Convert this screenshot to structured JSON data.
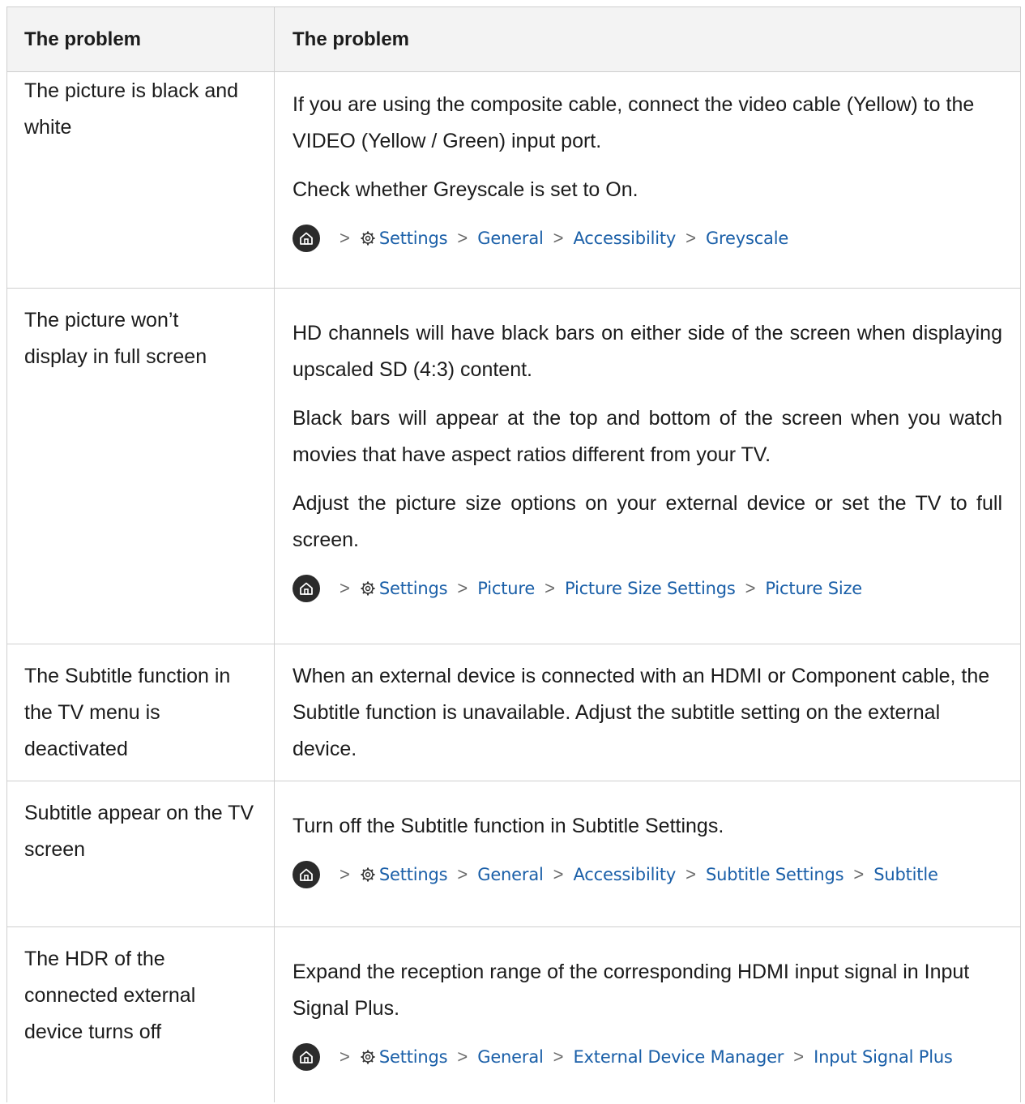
{
  "table": {
    "header": {
      "col1": "The problem",
      "col2": "The problem"
    },
    "rows": [
      {
        "problem": "The picture is black and white",
        "paragraphs": [
          "If you are using the composite cable, connect the video cable (Yellow) to the VIDEO (Yellow / Green) input port.",
          "Check whether Greyscale is set to On."
        ],
        "path": [
          "Settings",
          "General",
          "Accessibility",
          "Greyscale"
        ]
      },
      {
        "problem": "The picture won’t display in full screen",
        "paragraphs": [
          "HD channels will have black bars on either side of the screen when displaying upscaled SD (4:3) content.",
          "Black bars will appear at the top and bottom of the screen when you watch movies that have aspect ratios different from your TV.",
          "Adjust the picture size options on your external device or set the TV to full screen."
        ],
        "path": [
          "Settings",
          "Picture",
          "Picture Size Settings",
          "Picture Size"
        ]
      },
      {
        "problem": "The Subtitle function in the TV menu is deactivated",
        "paragraphs": [
          "When an external device is connected with an HDMI or Component cable, the Subtitle function is unavailable. Adjust the subtitle setting on the external device."
        ]
      },
      {
        "problem": "Subtitle appear on the TV screen",
        "paragraphs": [
          "Turn off the Subtitle function in Subtitle Settings."
        ],
        "path": [
          "Settings",
          "General",
          "Accessibility",
          "Subtitle Settings",
          "Subtitle"
        ]
      },
      {
        "problem": "The HDR of the connected external device turns off",
        "paragraphs": [
          "Expand the reception range of the corresponding HDMI input signal in Input Signal Plus."
        ],
        "path": [
          "Settings",
          "General",
          "External Device Manager",
          "Input Signal Plus"
        ]
      }
    ]
  },
  "icons": {
    "home": "home-icon",
    "gear": "gear-icon",
    "chevron": "chevron-right-icon"
  },
  "colors": {
    "link": "#1a5fa8",
    "header_bg": "#f3f3f3",
    "border": "#cfcfcf",
    "home_bg": "#2b2b2b"
  }
}
